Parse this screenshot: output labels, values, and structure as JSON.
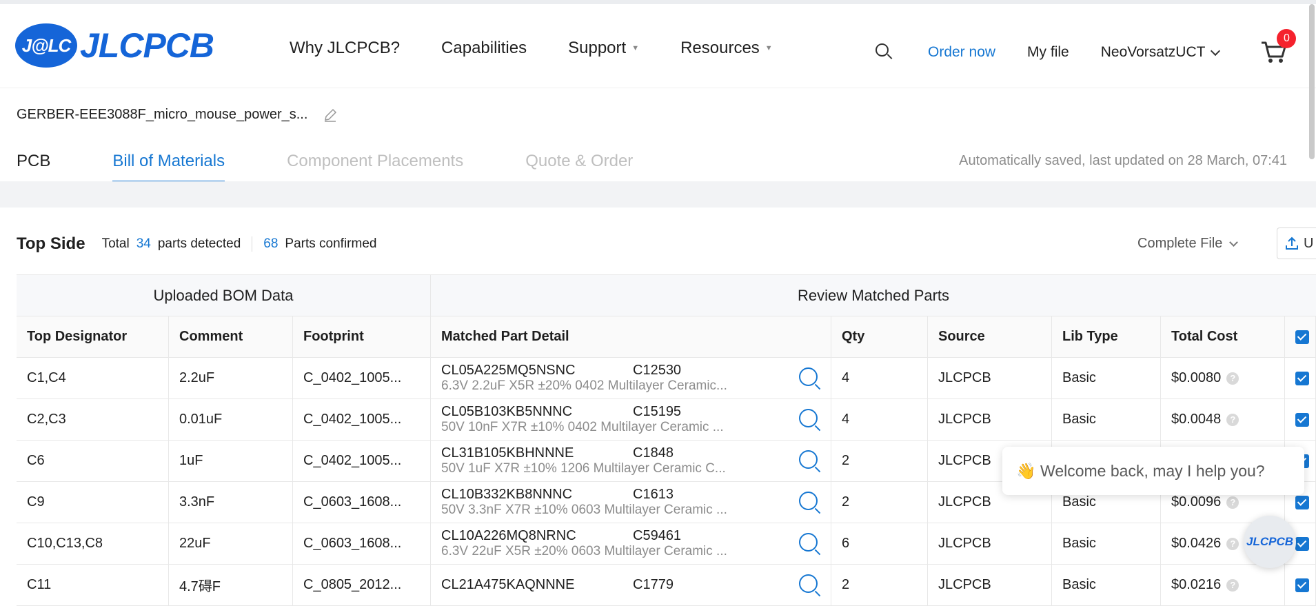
{
  "header": {
    "logo_badge": "J@LC",
    "logo_text": "JLCPCB",
    "nav": [
      {
        "label": "Why JLCPCB?",
        "dropdown": false
      },
      {
        "label": "Capabilities",
        "dropdown": false
      },
      {
        "label": "Support",
        "dropdown": true
      },
      {
        "label": "Resources",
        "dropdown": true
      }
    ],
    "order_now": "Order now",
    "my_file": "My file",
    "user": "NeoVorsatzUCT",
    "cart_count": "0"
  },
  "project": {
    "name": "GERBER-EEE3088F_micro_mouse_power_s..."
  },
  "tabs": [
    {
      "label": "PCB",
      "state": "normal"
    },
    {
      "label": "Bill of Materials",
      "state": "active"
    },
    {
      "label": "Component Placements",
      "state": "disabled"
    },
    {
      "label": "Quote & Order",
      "state": "disabled"
    }
  ],
  "saved_status": "Automatically saved, last updated on 28 March, 07:41",
  "topside": {
    "title": "Top Side",
    "total_label": "Total",
    "detected_count": "34",
    "detected_label": "parts detected",
    "confirmed_count": "68",
    "confirmed_label": "Parts confirmed",
    "complete_file": "Complete File",
    "upload_label": "U"
  },
  "table": {
    "group_uploaded": "Uploaded BOM Data",
    "group_review": "Review Matched Parts",
    "headers": [
      "Top Designator",
      "Comment",
      "Footprint",
      "Matched Part Detail",
      "Qty",
      "Source",
      "Lib Type",
      "Total Cost"
    ],
    "rows": [
      {
        "designator": "C1,C4",
        "comment": "2.2uF",
        "footprint": "C_0402_1005...",
        "mpn": "CL05A225MQ5NSNC",
        "lcsc": "C12530",
        "desc": "6.3V 2.2uF X5R ±20% 0402 Multilayer Ceramic...",
        "qty": "4",
        "source": "JLCPCB",
        "lib": "Basic",
        "cost": "$0.0080"
      },
      {
        "designator": "C2,C3",
        "comment": "0.01uF",
        "footprint": "C_0402_1005...",
        "mpn": "CL05B103KB5NNNC",
        "lcsc": "C15195",
        "desc": "50V 10nF X7R ±10% 0402 Multilayer Ceramic ...",
        "qty": "4",
        "source": "JLCPCB",
        "lib": "Basic",
        "cost": "$0.0048"
      },
      {
        "designator": "C6",
        "comment": "1uF",
        "footprint": "C_0402_1005...",
        "mpn": "CL31B105KBHNNNE",
        "lcsc": "C1848",
        "desc": "50V 1uF X7R ±10% 1206 Multilayer Ceramic C...",
        "qty": "2",
        "source": "JLCPCB",
        "lib": "",
        "cost": ""
      },
      {
        "designator": "C9",
        "comment": "3.3nF",
        "footprint": "C_0603_1608...",
        "mpn": "CL10B332KB8NNNC",
        "lcsc": "C1613",
        "desc": "50V 3.3nF X7R ±10% 0603 Multilayer Ceramic ...",
        "qty": "2",
        "source": "JLCPCB",
        "lib": "Basic",
        "cost": "$0.0096"
      },
      {
        "designator": "C10,C13,C8",
        "comment": "22uF",
        "footprint": "C_0603_1608...",
        "mpn": "CL10A226MQ8NRNC",
        "lcsc": "C59461",
        "desc": "6.3V 22uF X5R ±20% 0603 Multilayer Ceramic ...",
        "qty": "6",
        "source": "JLCPCB",
        "lib": "Basic",
        "cost": "$0.0426"
      },
      {
        "designator": "C11",
        "comment": "4.7碍F",
        "footprint": "C_0805_2012...",
        "mpn": "CL21A475KAQNNNE",
        "lcsc": "C1779",
        "desc": "",
        "qty": "2",
        "source": "JLCPCB",
        "lib": "Basic",
        "cost": "$0.0216"
      }
    ]
  },
  "chat": {
    "message": "👋 Welcome back, may I help you?",
    "fab_label": "JLCPCB"
  },
  "colors": {
    "brand": "#1565d8",
    "accent": "#1677d2",
    "badge": "#f5222d"
  }
}
